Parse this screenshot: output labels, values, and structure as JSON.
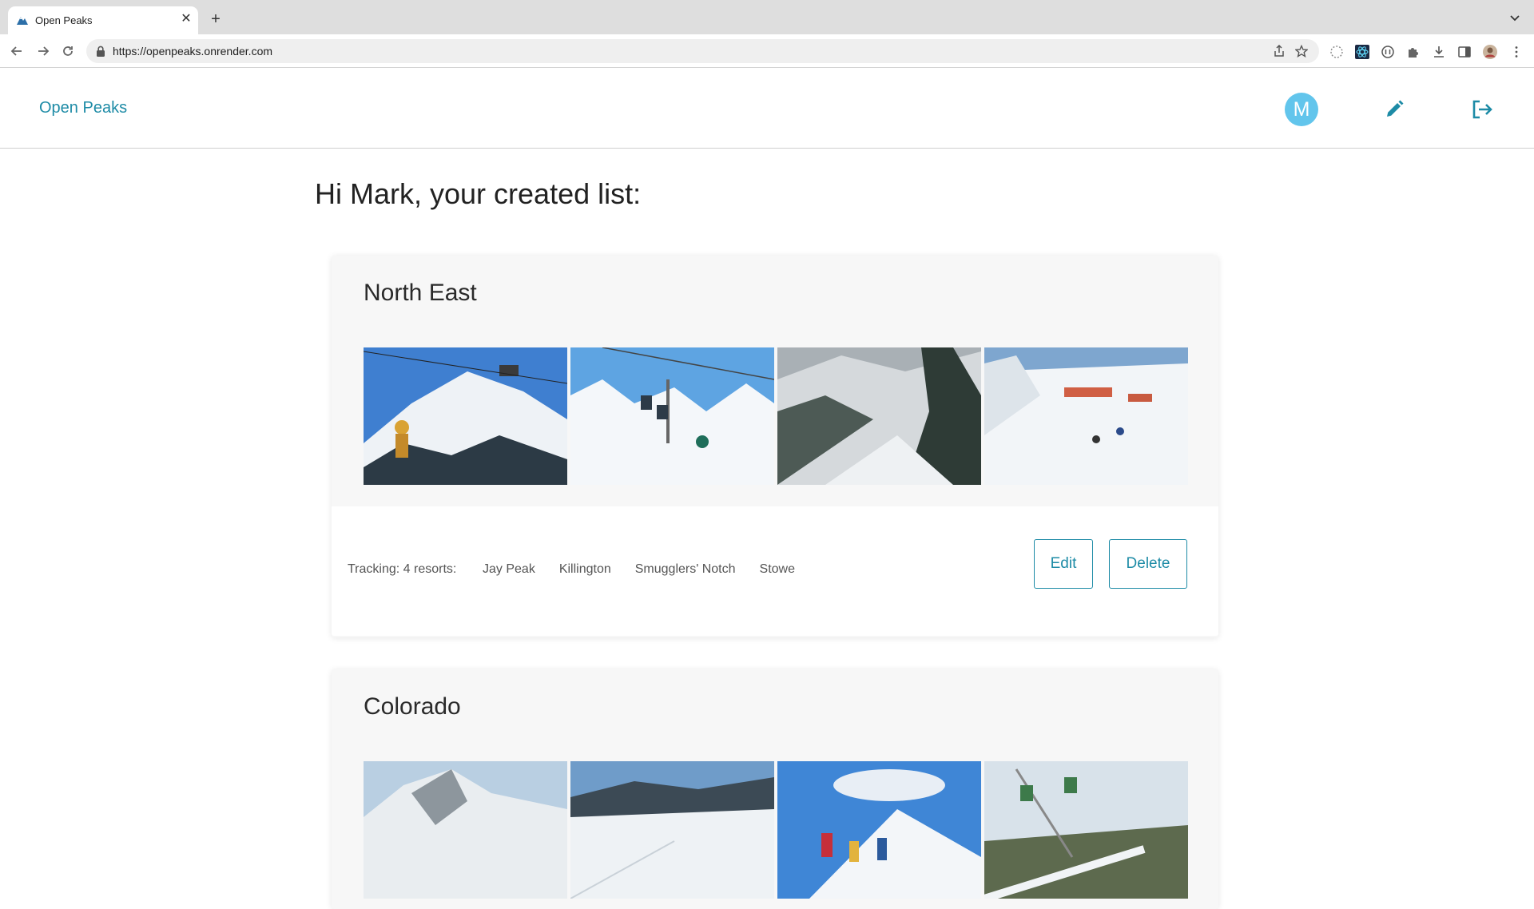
{
  "browser": {
    "tab_title": "Open Peaks",
    "url": "https://openpeaks.onrender.com"
  },
  "header": {
    "brand": "Open Peaks",
    "avatar_initial": "M"
  },
  "page": {
    "greeting": "Hi Mark, your created list:"
  },
  "lists": [
    {
      "title": "North East",
      "tracking_label": "Tracking: 4 resorts:",
      "resorts": [
        "Jay Peak",
        "Killington",
        "Smugglers' Notch",
        "Stowe"
      ],
      "edit_label": "Edit",
      "delete_label": "Delete"
    },
    {
      "title": "Colorado"
    }
  ],
  "colors": {
    "accent": "#1d8ba6",
    "avatar": "#62c5ec"
  }
}
